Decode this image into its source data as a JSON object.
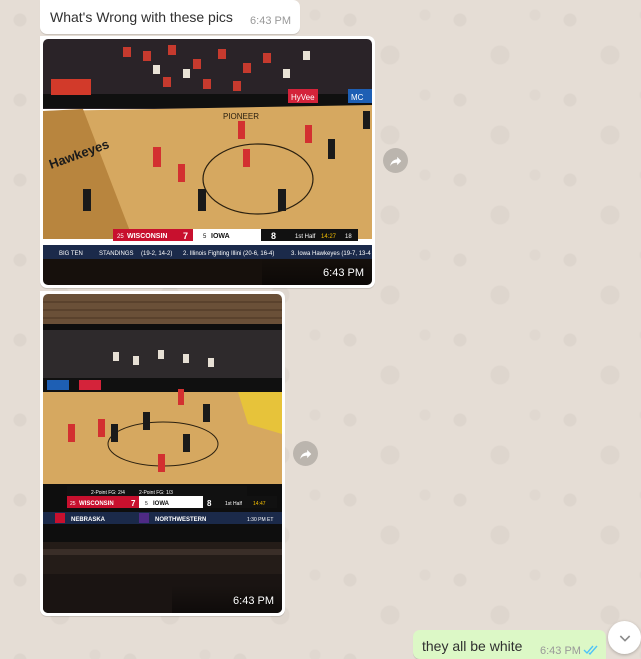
{
  "messages": [
    {
      "text": "What's Wrong with these pics",
      "time": "6:43 PM"
    },
    {
      "type": "image",
      "time": "6:43 PM",
      "description_icon": "basketball-broadcast-photo"
    },
    {
      "type": "image",
      "time": "6:43 PM",
      "description_icon": "basketball-tv-photo"
    },
    {
      "text": "they all be white",
      "time": "6:43 PM",
      "status": "read-double-check-icon"
    }
  ],
  "image1": {
    "banner_left": "Hawkeyes",
    "banner_ad": "HyVee",
    "banner_mc": "MC",
    "banner_pioneer": "PIONEER",
    "score_team_a": "WISCONSIN",
    "score_team_a_rank": "25",
    "score_a": "7",
    "score_team_b": "IOWA",
    "score_team_b_rank": "5",
    "score_b": "8",
    "half": "1st Half",
    "clock": "14:27",
    "shot": "18",
    "ticker_a": "BIG TEN",
    "ticker_b": "STANDINGS",
    "ticker_c": "(19-2, 14-2)",
    "ticker_d": "2. Illinois Fighting Illini (20-6, 16-4)",
    "ticker_e": "3. Iowa Hawkeyes (19-7, 13-4"
  },
  "image2": {
    "score_team_a": "WISCONSIN",
    "score_team_a_rank": "25",
    "score_a": "7",
    "score_team_b": "IOWA",
    "score_team_b_rank": "5",
    "score_b": "8",
    "half": "1st Half",
    "clock": "14:47",
    "stat_a": "2-Point FG: 2/4",
    "stat_b": "2-Point FG: 1/3",
    "ticker_a": "NEBRASKA",
    "ticker_b": "NORTHWESTERN",
    "ticker_time": "1:30 PM ET"
  },
  "colors": {
    "in_bubble": "#ffffff",
    "out_bubble": "#dcf8c6",
    "tick_read": "#4fc3f7",
    "wallpaper": "#e5ddd5"
  }
}
